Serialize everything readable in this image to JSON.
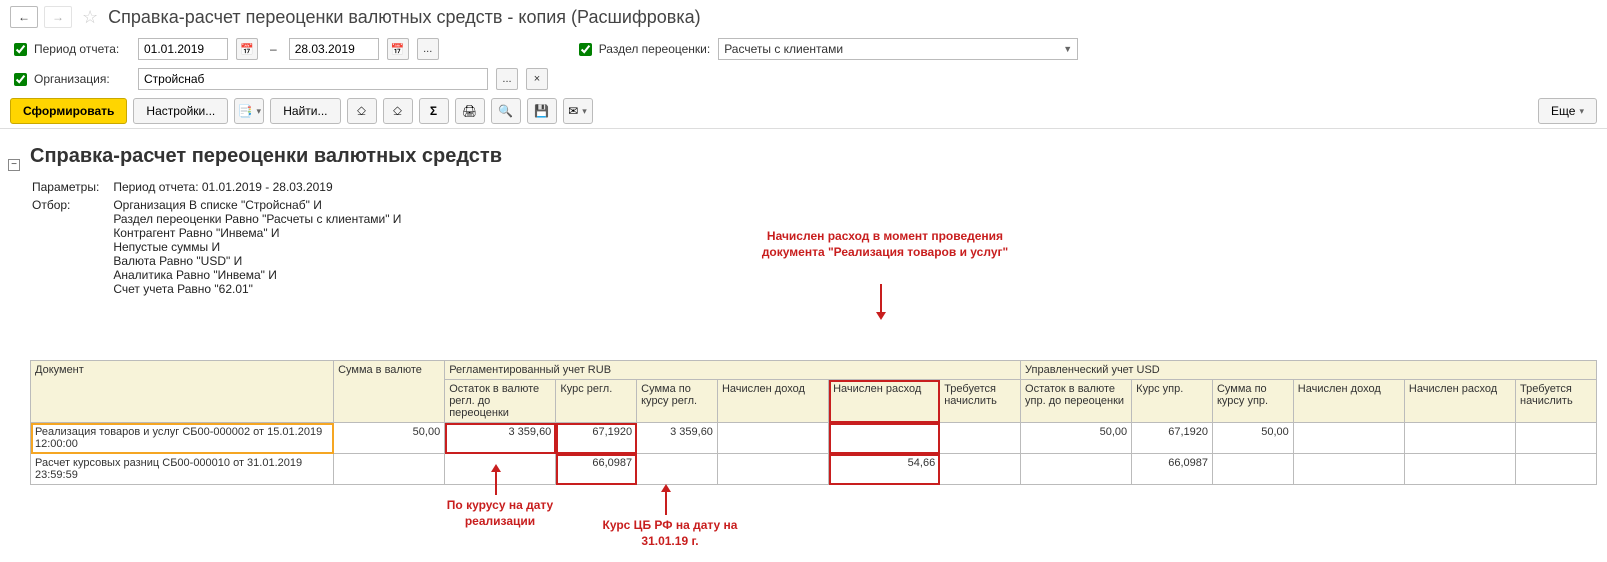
{
  "header": {
    "title": "Справка-расчет переоценки валютных средств - копия (Расшифровка)"
  },
  "filters": {
    "period_label": "Период отчета:",
    "date_from": "01.01.2019",
    "date_to": "28.03.2019",
    "section_label": "Раздел переоценки:",
    "section_value": "Расчеты с клиентами",
    "org_label": "Организация:",
    "org_value": "Стройснаб"
  },
  "toolbar": {
    "generate": "Сформировать",
    "settings": "Настройки...",
    "find": "Найти...",
    "more": "Еще"
  },
  "report": {
    "title": "Справка-расчет переоценки валютных средств",
    "param_label": "Параметры:",
    "param_value": "Период отчета: 01.01.2019 - 28.03.2019",
    "filter_label": "Отбор:",
    "filter_lines": [
      "Организация В списке \"Стройснаб\" И",
      "Раздел переоценки Равно \"Расчеты с клиентами\" И",
      "Контрагент Равно \"Инвема\" И",
      "Непустые суммы И",
      "Валюта Равно \"USD\" И",
      "Аналитика Равно \"Инвема\" И",
      "Счет учета Равно \"62.01\""
    ]
  },
  "columns": {
    "doc": "Документ",
    "amt_cur": "Сумма в валюте",
    "reg_group": "Регламентированный учет RUB",
    "reg_balance": "Остаток в валюте регл. до переоценки",
    "reg_rate": "Курс регл.",
    "reg_sum": "Сумма по курсу регл.",
    "reg_income": "Начислен доход",
    "reg_expense": "Начислен расход",
    "reg_need": "Требуется начислить",
    "mgmt_group": "Управленческий учет USD",
    "mgmt_balance": "Остаток в валюте упр. до переоценки",
    "mgmt_rate": "Курс упр.",
    "mgmt_sum": "Сумма по курсу упр.",
    "mgmt_income": "Начислен доход",
    "mgmt_expense": "Начислен расход",
    "mgmt_need": "Требуется начислить"
  },
  "rows": [
    {
      "doc": "Реализация товаров и услуг СБ00-000002 от 15.01.2019 12:00:00",
      "amt_cur": "50,00",
      "reg_balance": "3 359,60",
      "reg_rate": "67,1920",
      "reg_sum": "3 359,60",
      "reg_income": "",
      "reg_expense": "",
      "reg_need": "",
      "mgmt_balance": "50,00",
      "mgmt_rate": "67,1920",
      "mgmt_sum": "50,00",
      "mgmt_income": "",
      "mgmt_expense": "",
      "mgmt_need": ""
    },
    {
      "doc": "Расчет курсовых разниц СБ00-000010 от 31.01.2019 23:59:59",
      "amt_cur": "",
      "reg_balance": "",
      "reg_rate": "66,0987",
      "reg_sum": "",
      "reg_income": "",
      "reg_expense": "54,66",
      "reg_need": "",
      "mgmt_balance": "",
      "mgmt_rate": "66,0987",
      "mgmt_sum": "",
      "mgmt_income": "",
      "mgmt_expense": "",
      "mgmt_need": ""
    }
  ],
  "annotations": {
    "top": "Начислен расход в момент проведения документа \"Реализация товаров и услуг\"",
    "bottom_left": "По курусу на дату реализации",
    "bottom_right": "Курс ЦБ РФ на дату на 31.01.19 г."
  }
}
